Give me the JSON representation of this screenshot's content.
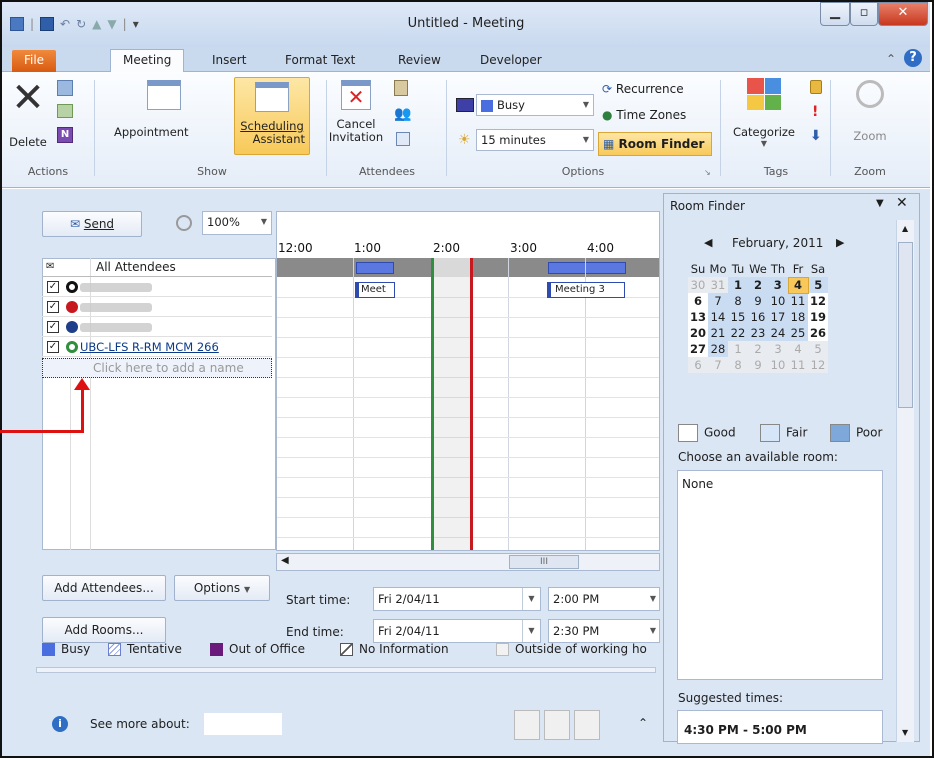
{
  "window": {
    "title": "Untitled - Meeting"
  },
  "tabs": [
    "File",
    "Meeting",
    "Insert",
    "Format Text",
    "Review",
    "Developer"
  ],
  "ribbon": {
    "actions": {
      "delete": "Delete",
      "group": "Actions"
    },
    "show": {
      "appointment": "Appointment",
      "scheduling1": "Scheduling",
      "scheduling2": "Assistant",
      "group": "Show"
    },
    "attendees": {
      "cancel1": "Cancel",
      "cancel2": "Invitation",
      "group": "Attendees"
    },
    "options": {
      "showas": "Busy",
      "reminder": "15 minutes",
      "recurrence": "Recurrence",
      "timezones": "Time Zones",
      "roomfinder": "Room Finder",
      "group": "Options"
    },
    "tags": {
      "categorize": "Categorize",
      "group": "Tags"
    },
    "zoom": {
      "zoom": "Zoom",
      "group": "Zoom"
    }
  },
  "scheduler": {
    "send": "Send",
    "zoom": "100%",
    "times": [
      "12:00",
      "1:00",
      "2:00",
      "3:00",
      "4:00"
    ],
    "all_attendees": "All Attendees",
    "attendee4": "UBC-LFS R-RM MCM 266",
    "add_placeholder": "Click here to add a name",
    "meet1": "Meet",
    "meet3": "Meeting 3",
    "scroll_mid": "III"
  },
  "bottom": {
    "add_attendees": "Add Attendees...",
    "options": "Options",
    "add_rooms": "Add Rooms...",
    "start_label": "Start time:",
    "end_label": "End time:",
    "start_date": "Fri 2/04/11",
    "start_time": "2:00 PM",
    "end_date": "Fri 2/04/11",
    "end_time": "2:30 PM"
  },
  "legend": {
    "busy": "Busy",
    "tentative": "Tentative",
    "ooo": "Out of Office",
    "noinfo": "No Information",
    "outside": "Outside of working ho"
  },
  "people": {
    "see_more": "See more about:"
  },
  "roomfinder": {
    "title": "Room Finder",
    "month": "February, 2011",
    "days": [
      "Su",
      "Mo",
      "Tu",
      "We",
      "Th",
      "Fr",
      "Sa"
    ],
    "weeks": [
      [
        "30",
        "31",
        "1",
        "2",
        "3",
        "4",
        "5"
      ],
      [
        "6",
        "7",
        "8",
        "9",
        "10",
        "11",
        "12"
      ],
      [
        "13",
        "14",
        "15",
        "16",
        "17",
        "18",
        "19"
      ],
      [
        "20",
        "21",
        "22",
        "23",
        "24",
        "25",
        "26"
      ],
      [
        "27",
        "28",
        "1",
        "2",
        "3",
        "4",
        "5"
      ],
      [
        "6",
        "7",
        "8",
        "9",
        "10",
        "11",
        "12"
      ]
    ],
    "good": "Good",
    "fair": "Fair",
    "poor": "Poor",
    "choose": "Choose an available room:",
    "room": "None",
    "suggested": "Suggested times:",
    "suggestion": "4:30 PM - 5:00 PM"
  }
}
